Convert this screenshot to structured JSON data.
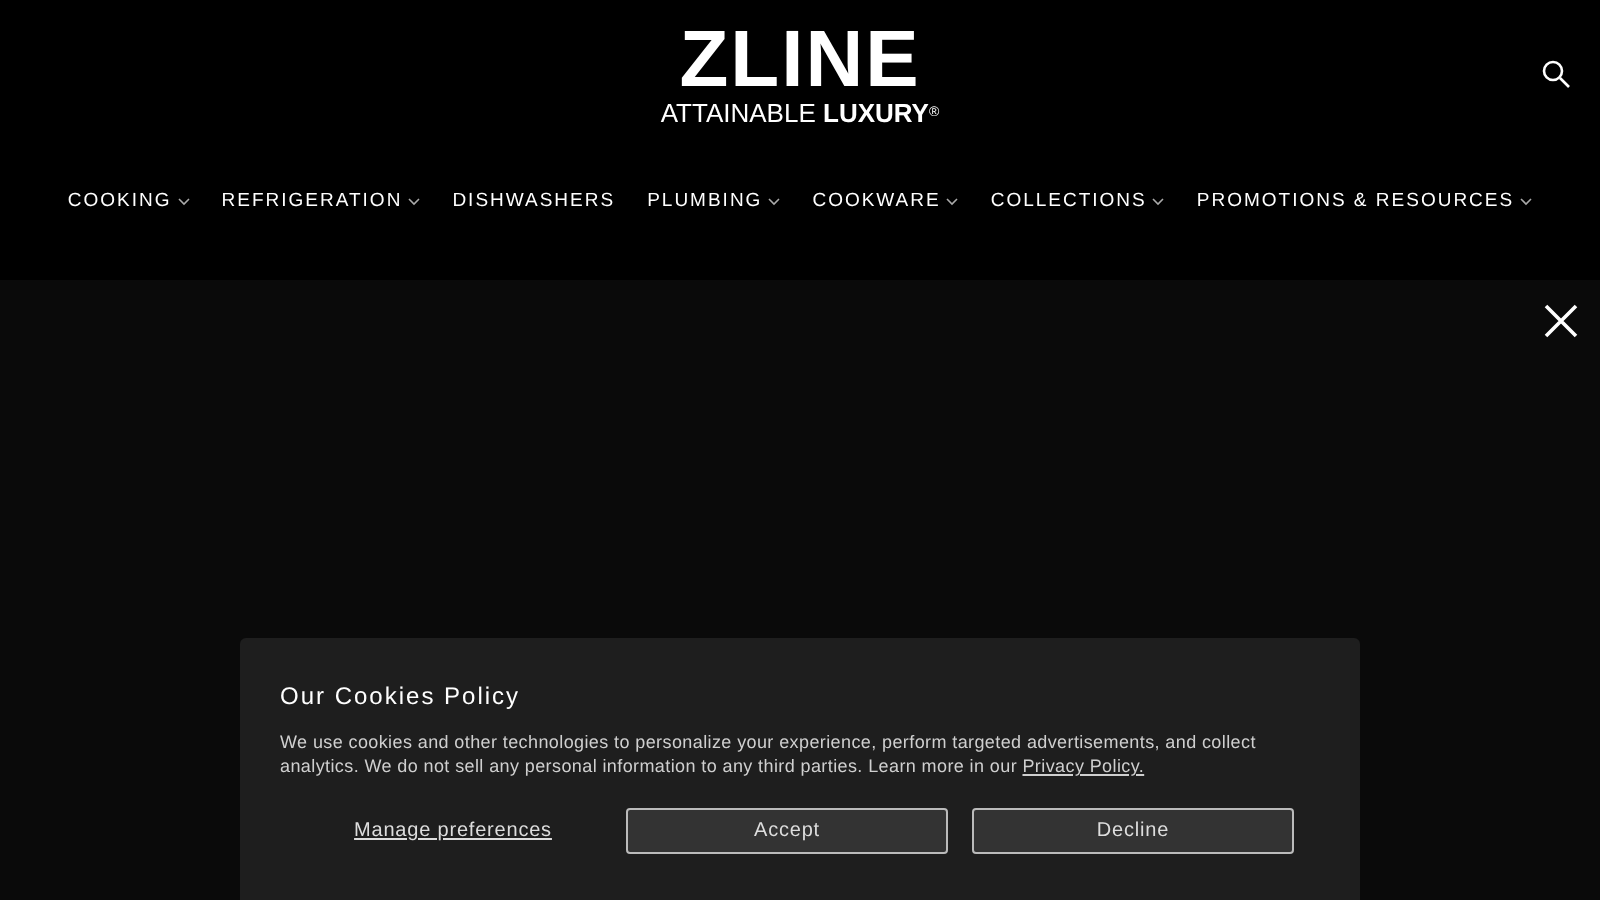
{
  "logo": {
    "name": "ZLINE",
    "tagline_light": "ATTAINABLE",
    "tagline_bold": "LUXURY",
    "mark": "®"
  },
  "nav": [
    {
      "label": "COOKING",
      "dropdown": true
    },
    {
      "label": "REFRIGERATION",
      "dropdown": true
    },
    {
      "label": "DISHWASHERS",
      "dropdown": false
    },
    {
      "label": "PLUMBING",
      "dropdown": true
    },
    {
      "label": "COOKWARE",
      "dropdown": true
    },
    {
      "label": "COLLECTIONS",
      "dropdown": true
    },
    {
      "label": "PROMOTIONS & RESOURCES",
      "dropdown": true
    }
  ],
  "cookie_banner": {
    "title": "Our Cookies Policy",
    "text": "We use cookies and other technologies to personalize your experience, perform targeted advertisements, and collect analytics. We do not sell any personal information to any third parties. Learn more in our",
    "link": "Privacy Policy.",
    "manage": "Manage preferences",
    "buttons": [
      "Accept",
      "Decline"
    ]
  }
}
